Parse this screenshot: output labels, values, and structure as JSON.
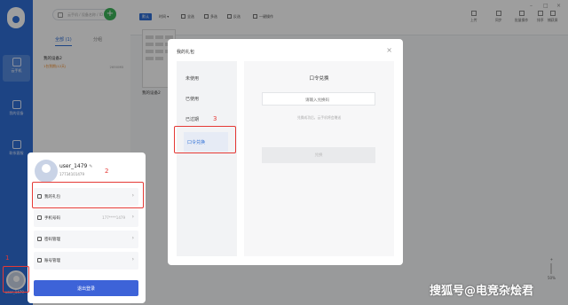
{
  "rail": {
    "items": [
      {
        "label": "云手机",
        "icon": "phone-icon"
      },
      {
        "label": "我的设备",
        "icon": "device-icon"
      },
      {
        "label": "联系客服",
        "icon": "headset-icon"
      }
    ],
    "avatar_label": "user_1479"
  },
  "device_pane": {
    "search_placeholder": "云手机 / 设备名称 / ID",
    "tabs": [
      "全部 (1)",
      "分组"
    ],
    "device": {
      "name": "我的设备2",
      "sub": "1台到期(12天)",
      "meta": "2690MB"
    }
  },
  "toolbar": {
    "left_items": [
      "默认",
      "时间 ▾",
      "全选",
      "多选",
      "反选",
      "一键操作"
    ],
    "right_items": [
      "上传",
      "同步",
      "批量操作",
      "排序",
      "捕获屏"
    ]
  },
  "main": {
    "thumb_label": "我的设备2",
    "zoom": "50%"
  },
  "dialog": {
    "title": "我的礼包",
    "close": "×",
    "menu": [
      "未使用",
      "已使用",
      "已过期",
      "口令兑换"
    ],
    "selected_index": 3,
    "content_title": "口令兑换",
    "input_placeholder": "请输入兑换码",
    "hint": "兑换成功后，云手机将会赠送",
    "button": "兑换"
  },
  "popover": {
    "username": "user_1479",
    "edit_icon": "✎",
    "phone": "17734101479",
    "rows": [
      {
        "label": "我的礼包",
        "value": ""
      },
      {
        "label": "手机号码",
        "value": "177****1479"
      },
      {
        "label": "密码管理",
        "value": ""
      },
      {
        "label": "账号管理",
        "value": ""
      }
    ],
    "logout": "退出登录"
  },
  "annotations": {
    "n1": "1",
    "n2": "2",
    "n3": "3"
  },
  "watermark": "搜狐号@电竞杂烩君",
  "colors": {
    "brand": "#2f6fd6",
    "annotation": "#e53935",
    "logout": "#3d63d8"
  }
}
